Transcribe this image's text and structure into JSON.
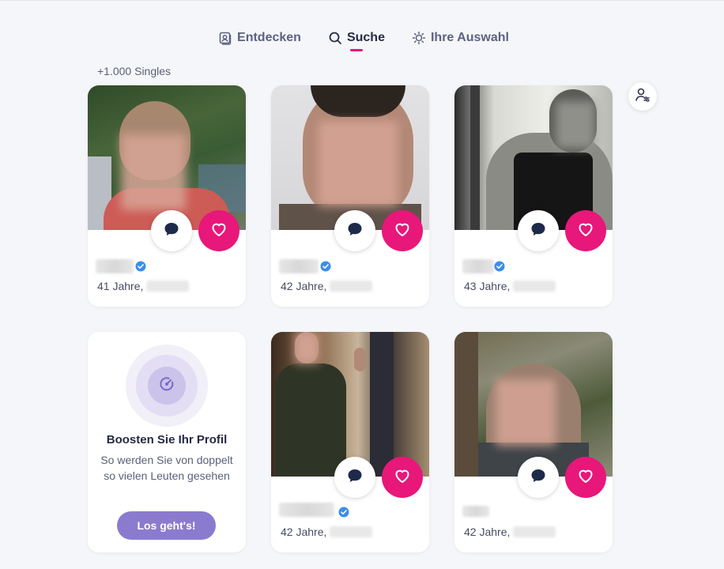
{
  "tabs": [
    {
      "label": "Entdecken",
      "icon": "profile-card-icon",
      "active": false
    },
    {
      "label": "Suche",
      "icon": "search-icon",
      "active": true
    },
    {
      "label": "Ihre Auswahl",
      "icon": "sparkle-icon",
      "active": false
    }
  ],
  "results_count": "+1.000 Singles",
  "profiles": [
    {
      "age_text": "41 Jahre,",
      "verified": true
    },
    {
      "age_text": "42 Jahre,",
      "verified": true
    },
    {
      "age_text": "43 Jahre,",
      "verified": true
    },
    {
      "age_text": "42 Jahre,",
      "verified": true
    },
    {
      "age_text": "42 Jahre,",
      "verified": false
    }
  ],
  "boost": {
    "title": "Boosten Sie Ihr Profil",
    "text": "So werden Sie von doppelt so vielen Leuten gesehen",
    "button": "Los geht's!"
  },
  "colors": {
    "accent_pink": "#e8177a",
    "boost_purple": "#8a7bcf",
    "verified_blue": "#3b8eea"
  }
}
